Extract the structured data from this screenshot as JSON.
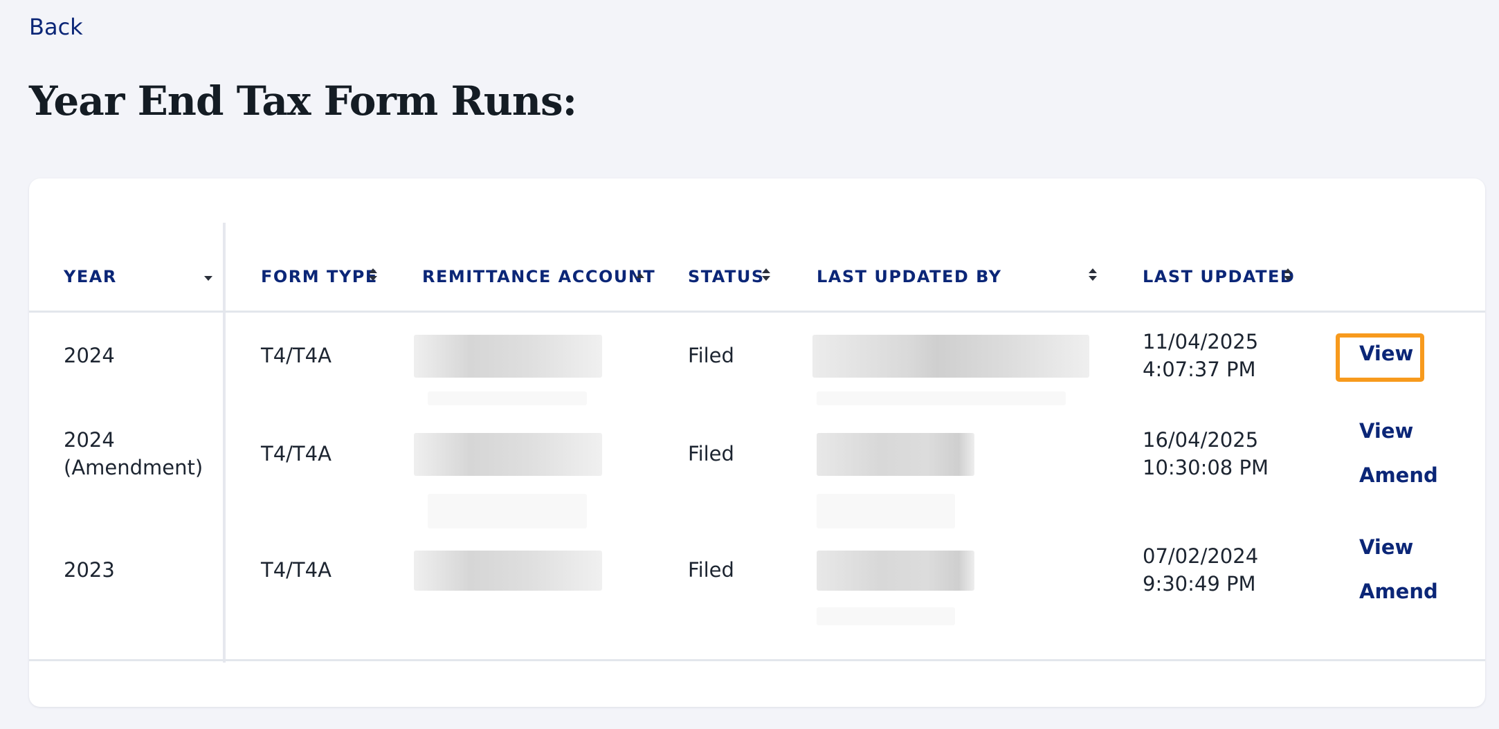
{
  "nav": {
    "back_label": "Back"
  },
  "page": {
    "title": "Year End Tax Form Runs:"
  },
  "table": {
    "columns": {
      "year": "YEAR",
      "form_type": "FORM TYPE",
      "remittance_account": "REMITTANCE ACCOUNT",
      "status": "STATUS",
      "last_updated_by": "LAST UPDATED BY",
      "last_updated": "LAST UPDATED"
    },
    "sort": {
      "column": "remittance_account",
      "direction": "ascending"
    },
    "rows": [
      {
        "year_line1": "2024",
        "year_line2": "",
        "form_type": "T4/T4A",
        "status": "Filed",
        "date": "11/04/2025",
        "time": "4:07:37 PM",
        "actions": [
          "View"
        ]
      },
      {
        "year_line1": "2024",
        "year_line2": "(Amendment)",
        "form_type": "T4/T4A",
        "status": "Filed",
        "date": "16/04/2025",
        "time": "10:30:08 PM",
        "actions": [
          "View",
          "Amend"
        ]
      },
      {
        "year_line1": "2023",
        "year_line2": "",
        "form_type": "T4/T4A",
        "status": "Filed",
        "date": "07/02/2024",
        "time": "9:30:49 PM",
        "actions": [
          "View",
          "Amend"
        ]
      }
    ]
  },
  "colors": {
    "link": "#0b2677",
    "highlight": "#f79a1d",
    "background": "#f3f4f9"
  }
}
